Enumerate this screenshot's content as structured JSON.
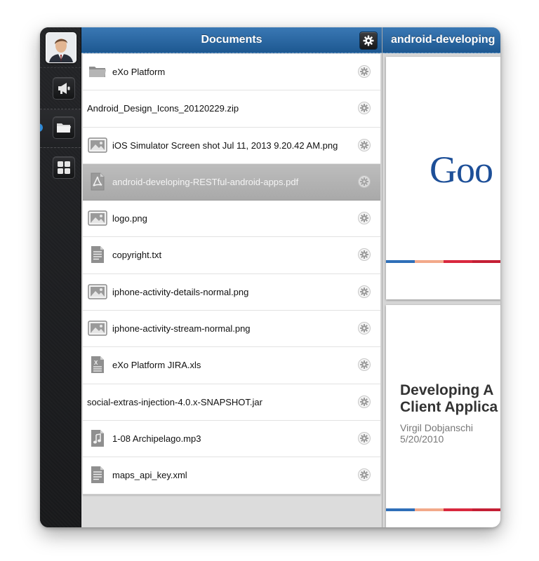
{
  "documents_panel": {
    "title": "Documents",
    "files": [
      {
        "name": "eXo Platform",
        "icon": "folder-icon",
        "selected": false
      },
      {
        "name": "Android_Design_Icons_20120229.zip",
        "icon": "",
        "selected": false
      },
      {
        "name": "iOS Simulator Screen shot Jul 11, 2013 9.20.42 AM.png",
        "icon": "image-file-icon",
        "selected": false
      },
      {
        "name": "android-developing-RESTful-android-apps.pdf",
        "icon": "pdf-file-icon",
        "selected": true
      },
      {
        "name": "logo.png",
        "icon": "image-file-icon",
        "selected": false
      },
      {
        "name": "copyright.txt",
        "icon": "text-file-icon",
        "selected": false
      },
      {
        "name": "iphone-activity-details-normal.png",
        "icon": "image-file-icon",
        "selected": false
      },
      {
        "name": "iphone-activity-stream-normal.png",
        "icon": "image-file-icon",
        "selected": false
      },
      {
        "name": "eXo Platform JIRA.xls",
        "icon": "spreadsheet-file-icon",
        "selected": false
      },
      {
        "name": "social-extras-injection-4.0.x-SNAPSHOT.jar",
        "icon": "",
        "selected": false
      },
      {
        "name": "1-08 Archipelago.mp3",
        "icon": "audio-file-icon",
        "selected": false
      },
      {
        "name": "maps_api_key.xml",
        "icon": "text-file-icon",
        "selected": false
      }
    ]
  },
  "preview": {
    "title": "android-developing",
    "page1_logo_text": "Goo",
    "page2_title_line1": "Developing A",
    "page2_title_line2": "Client Applica",
    "page2_author": "Virgil Dobjanschi",
    "page2_date": "5/20/2010"
  },
  "nav": {
    "items": [
      "avatar",
      "megaphone-icon",
      "folder-icon",
      "dashboard-grid-icon"
    ],
    "active": "folder-icon"
  },
  "colors": {
    "header_blue": "#1d5891",
    "selected_row": "#afafaf",
    "stripe": [
      "#2f6fb8",
      "#f2a98a",
      "#d9283e",
      "#c41f35"
    ]
  }
}
